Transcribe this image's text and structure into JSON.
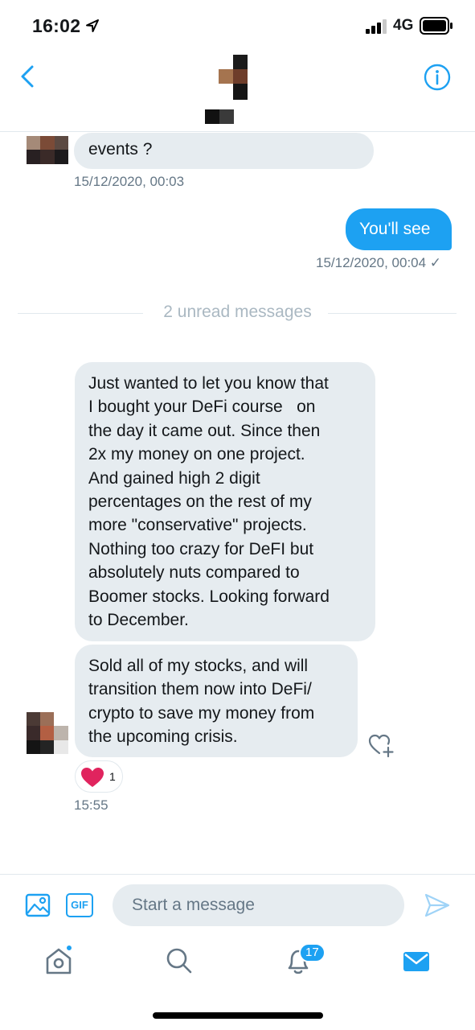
{
  "status_bar": {
    "time": "16:02",
    "network": "4G"
  },
  "header": {
    "back_icon": "chevron-left-icon",
    "info_icon": "info-circle-icon",
    "accent_color": "#1da1f2"
  },
  "messages": [
    {
      "direction": "received",
      "text": "events ?",
      "timestamp": "15/12/2020, 00:03"
    },
    {
      "direction": "sent",
      "text": "You'll see",
      "timestamp": "15/12/2020, 00:04 ✓"
    },
    {
      "direction": "received",
      "lines": [
        "Just wanted to let you know that",
        "I bought your DeFi course   on",
        "the day it came out. Since then",
        "2x my money on one project.",
        "And gained high 2 digit",
        "percentages on the rest of my",
        "more \"conservative\" projects.",
        "Nothing too crazy for DeFI but",
        "absolutely nuts compared to",
        "Boomer stocks. Looking forward",
        "to December."
      ]
    },
    {
      "direction": "received",
      "lines": [
        "Sold all of my stocks, and will",
        "transition them now into DeFi/",
        "crypto to save my money from",
        "the upcoming crisis."
      ],
      "timestamp": "15:55",
      "reaction": {
        "icon": "heart-icon",
        "count": "1"
      }
    }
  ],
  "unread_divider": "2 unread messages",
  "composer": {
    "placeholder": "Start a message",
    "gif_label": "GIF"
  },
  "tabbar": {
    "notifications_badge": "17",
    "active_tab": "messages"
  },
  "colors": {
    "accent": "#1da1f2",
    "received_bubble": "#e6ecf0",
    "muted_text": "#657786",
    "heart": "#e0245e"
  }
}
